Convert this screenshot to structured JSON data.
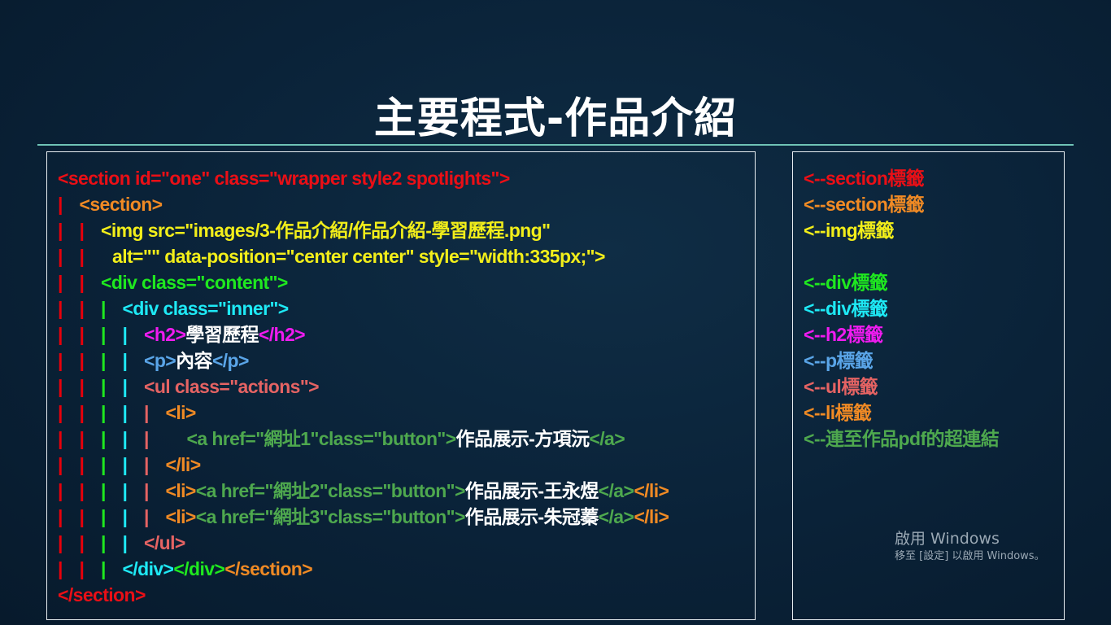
{
  "slide": {
    "title": "主要程式-作品介紹"
  },
  "code": {
    "l1": "<section id=\"one\" class=\"wrapper style2 spotlights\">",
    "l2": "<section>",
    "l3": "<img src=\"images/3-作品介紹/作品介紹-學習歷程.png\"",
    "l4": "alt=\"\" data-position=\"center center\" style=\"width:335px;\">",
    "l5": "<div class=\"content\">",
    "l6": "<div class=\"inner\">",
    "l7_open": "<h2>",
    "l7_text": "學習歷程",
    "l7_close": "</h2>",
    "l8_open": "<p>",
    "l8_text": "內容",
    "l8_close": "</p>",
    "l9": "<ul class=\"actions\">",
    "l10": "<li>",
    "l11_a": "<a href=\"網址1\"class=\"button\">",
    "l11_text": "作品展示-方項沅",
    "l11_close": "</a>",
    "l12": "</li>",
    "l13_li": "<li>",
    "l13_a": "<a href=\"網址2\"class=\"button\">",
    "l13_text": "作品展示-王永煜",
    "l13_close_a": "</a>",
    "l13_close_li": "</li>",
    "l14_li": "<li>",
    "l14_a": "<a href=\"網址3\"class=\"button\">",
    "l14_text": "作品展示-朱冠蓁",
    "l14_close_a": "</a>",
    "l14_close_li": "</li>",
    "l15": "</ul>",
    "l16_div1": "</div>",
    "l16_div2": "</div>",
    "l16_section": "</section>",
    "l17": "</section>",
    "pipe": "|"
  },
  "notes": {
    "n1": "<--section標籤",
    "n2": "<--section標籤",
    "n3": "<--img標籤",
    "n5": "<--div標籤",
    "n6": "<--div標籤",
    "n7": "<--h2標籤",
    "n8": "<--p標籤",
    "n9": "<--ul標籤",
    "n10": "<--li標籤",
    "n11": "<--連至作品pdf的超連結"
  },
  "watermark": {
    "line1": "啟用 Windows",
    "line2": "移至 [設定] 以啟用 Windows。"
  },
  "colors": {
    "section_outer": "#ea0f16",
    "section_inner": "#f08a24",
    "img": "#f2ee1a",
    "div_content": "#1fe81f",
    "div_inner": "#1ee9f5",
    "h2": "#f01bf0",
    "p": "#5aa5e8",
    "ul": "#e56363",
    "li": "#f08a24",
    "a": "#4ea84e",
    "rule": "#6fc3b6"
  }
}
